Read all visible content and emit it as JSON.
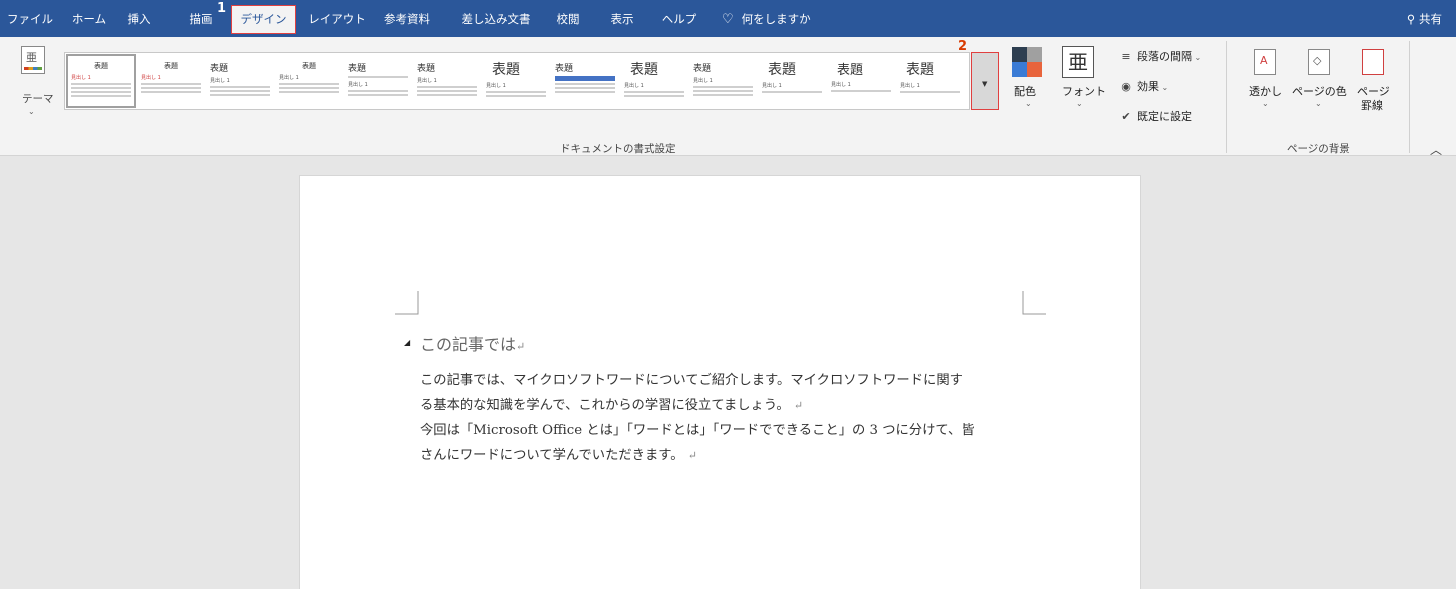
{
  "tabs": [
    "ファイル",
    "ホーム",
    "挿入",
    "描画",
    "デザイン",
    "レイアウト",
    "参考資料",
    "差し込み文書",
    "校閲",
    "表示",
    "ヘルプ"
  ],
  "active_tab": "デザイン",
  "tell_me": "何をしますか",
  "share": "共有",
  "steps": [
    "1",
    "2"
  ],
  "ribbon": {
    "theme_label": "テーマ",
    "gallery_items": [
      {
        "title": "表題",
        "style": "small"
      },
      {
        "title": "表題",
        "style": "small"
      },
      {
        "title": "表題",
        "style": "mid"
      },
      {
        "title": "表題",
        "style": "small"
      },
      {
        "title": "表題",
        "style": "mid"
      },
      {
        "title": "表題",
        "style": "mid"
      },
      {
        "title": "表題",
        "style": "big"
      },
      {
        "title": "表題",
        "style": "mid"
      },
      {
        "title": "表題",
        "style": "big"
      },
      {
        "title": "表題",
        "style": "mid"
      },
      {
        "title": "表題",
        "style": "big"
      },
      {
        "title": "表題",
        "style": "big"
      },
      {
        "title": "表題",
        "style": "big"
      }
    ],
    "gallery_heading_sample": "見出し 1",
    "group_document_format": "ドキュメントの書式設定",
    "colors_label": "配色",
    "fonts_label": "フォント",
    "paragraph_spacing": "段落の間隔",
    "effects": "効果",
    "set_default": "既定に設定",
    "watermark": "透かし",
    "page_color": "ページの色",
    "page_borders_line1": "ページ",
    "page_borders_line2": "罫線",
    "group_page_background": "ページの背景",
    "colors": {
      "accent": "#2b579a",
      "highlight": "#e04040"
    }
  },
  "document": {
    "heading": "この記事では",
    "lines": [
      "この記事では、マイクロソフトワードについてご紹介します。マイクロソフトワードに関す",
      "る基本的な知識を学んで、これからの学習に役立てましょう。",
      "今回は「Microsoft Office とは」「ワードとは」「ワードでできること」の 3 つに分けて、皆",
      "さんにワードについて学んでいただきます。"
    ],
    "para_mark": "↵"
  }
}
